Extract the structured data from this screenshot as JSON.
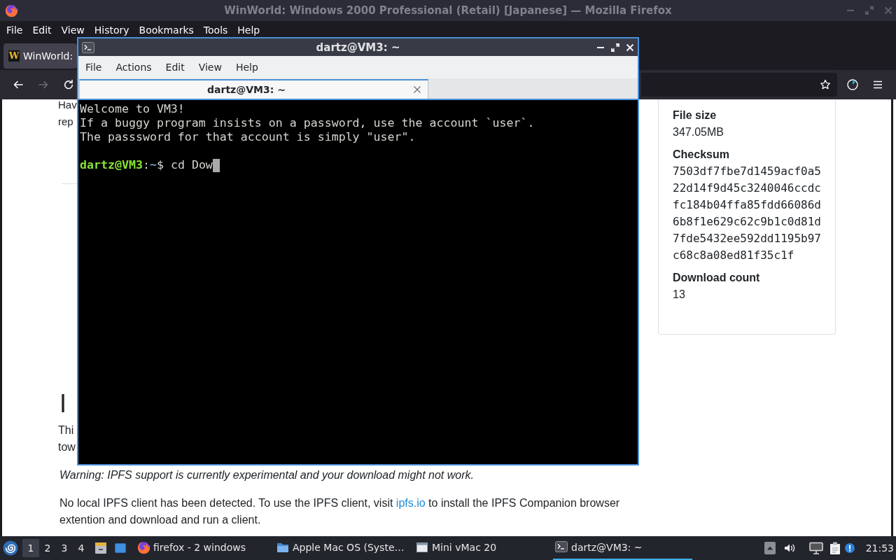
{
  "browser_window": {
    "title": "WinWorld: Windows 2000 Professional (Retail) [Japanese] — Mozilla Firefox",
    "active": false,
    "menu": [
      "File",
      "Edit",
      "View",
      "History",
      "Bookmarks",
      "Tools",
      "Help"
    ],
    "tabs": [
      {
        "favicon": "W",
        "label": "WinWorld:",
        "selected": true
      }
    ],
    "nav_buttons": [
      {
        "kind": "back",
        "disabled": false
      },
      {
        "kind": "forward",
        "disabled": true
      },
      {
        "kind": "reload",
        "disabled": false
      }
    ],
    "toolbar_buttons": [
      {
        "kind": "ring"
      },
      {
        "kind": "menu"
      }
    ]
  },
  "page": {
    "top_fragments": [
      "Hav",
      "rep"
    ],
    "ipfs_heading": "I",
    "ipfs_fragments": [
      "Thi",
      "tow"
    ],
    "warning": "Warning: IPFS support is currently experimental and your download might not work.",
    "notice": {
      "before": "No local IPFS client has been detected. To use the IPFS client, visit",
      "link": "ipfs.io",
      "after": "to install the IPFS Companion browser extention and download and run a client."
    },
    "details": [
      {
        "kind": "text",
        "label": "File size",
        "value": "347.05MB"
      },
      {
        "kind": "mono",
        "label": "Checksum",
        "value": "7503df7fbe7d1459acf0a522d14f9d45c3240046ccdcfc184b04ffa85fdd66086d6b8f1e629c62c9b1c0d81d7fde5432ee592dd1195b97c68c8a08ed81f35c1f"
      },
      {
        "kind": "text",
        "label": "Download count",
        "value": "13"
      }
    ]
  },
  "terminal_window": {
    "title": "dartz@VM3: ~",
    "active": true,
    "menu": [
      "File",
      "Actions",
      "Edit",
      "View",
      "Help"
    ],
    "tabs": [
      {
        "label": "dartz@VM3: ~",
        "selected": true
      }
    ],
    "output": [
      "Welcome to VM3!",
      "If a buggy program insists on a password, use the account `user`.",
      "The passsword for that account is simply \"user\"."
    ],
    "prompt": {
      "user_host": "dartz@VM3",
      "separator": ":",
      "path": "~",
      "symbol": "$",
      "command": "cd Dow"
    }
  },
  "taskbar": {
    "workspaces": [
      {
        "label": "1",
        "selected": true
      },
      {
        "label": "2",
        "selected": false
      },
      {
        "label": "3",
        "selected": false
      },
      {
        "label": "4",
        "selected": false
      }
    ],
    "launchers": [
      {
        "kind": "files"
      },
      {
        "kind": "desktop"
      }
    ],
    "tasks": [
      {
        "kind": "browser",
        "label": "firefox - 2 windows",
        "selected": false
      },
      {
        "kind": "folder",
        "label": "Apple Mac OS (Syste…",
        "selected": false
      },
      {
        "kind": "window",
        "label": "Mini vMac 20",
        "selected": false
      },
      {
        "kind": "terminal",
        "label": "dartz@VM3: ~",
        "selected": true
      }
    ],
    "tray": [
      {
        "kind": "arrow"
      },
      {
        "kind": "speaker"
      },
      {
        "kind": "network"
      },
      {
        "kind": "clipboard"
      },
      {
        "kind": "info"
      }
    ],
    "clock": "21:53"
  }
}
